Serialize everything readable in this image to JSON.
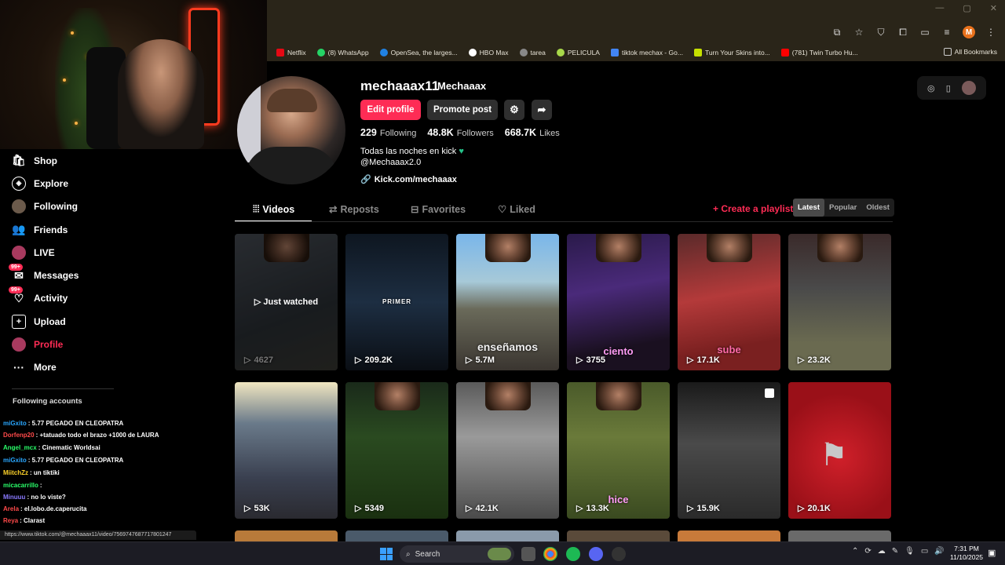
{
  "bookmarks": [
    {
      "label": "Netflix",
      "color": "#e50914"
    },
    {
      "label": "(8) WhatsApp",
      "color": "#25d366"
    },
    {
      "label": "OpenSea, the larges...",
      "color": "#2081e2"
    },
    {
      "label": "HBO Max",
      "color": "#ffffff"
    },
    {
      "label": "tarea",
      "color": "#888888"
    },
    {
      "label": "PELICULA",
      "color": "#a8d84a"
    },
    {
      "label": "tiktok mechax - Go...",
      "color": "#4285f4"
    },
    {
      "label": "Turn Your Skins into...",
      "color": "#c6e000"
    },
    {
      "label": "(781) Twin Turbo Hu...",
      "color": "#ff0000"
    }
  ],
  "all_bookmarks": "All Bookmarks",
  "profile_initial": "M",
  "sidebar": {
    "items": [
      {
        "label": "Shop",
        "icon": "shop-icon"
      },
      {
        "label": "Explore",
        "icon": "compass-icon"
      },
      {
        "label": "Following",
        "icon": "avatar-icon"
      },
      {
        "label": "Friends",
        "icon": "friends-icon"
      },
      {
        "label": "LIVE",
        "icon": "live-icon"
      },
      {
        "label": "Messages",
        "icon": "messages-icon",
        "badge": "99+"
      },
      {
        "label": "Activity",
        "icon": "activity-icon",
        "badge": "99+"
      },
      {
        "label": "Upload",
        "icon": "upload-icon"
      },
      {
        "label": "Profile",
        "icon": "profile-icon"
      },
      {
        "label": "More",
        "icon": "more-icon"
      }
    ],
    "following_accounts_title": "Following accounts"
  },
  "chat": [
    {
      "user": "miGxito",
      "msg": ": 5.77 PEGADO EN CLEOPATRA",
      "color": "#2aa7ff"
    },
    {
      "user": "Dorfenp20",
      "msg": ": +tatuado todo el brazo +1000 de LAURA",
      "color": "#ff4a4a"
    },
    {
      "user": "Angel_mcx",
      "msg": ": Cinematic Worldsai",
      "color": "#2aff6a"
    },
    {
      "user": "miGxito",
      "msg": ": 5.77 PEGADO EN CLEOPATRA",
      "color": "#2aa7ff"
    },
    {
      "user": "MiitchZz",
      "msg": ": un tiktiki",
      "color": "#ffd42a"
    },
    {
      "user": "micacarrillo",
      "msg": ":",
      "color": "#2aff6a"
    },
    {
      "user": "Minuuu",
      "msg": ": no lo viste?",
      "color": "#8a7aff"
    },
    {
      "user": "Arela",
      "msg": ": el.lobo.de.caperucita",
      "color": "#ff4a4a"
    },
    {
      "user": "Reya",
      "msg": ": Clarast",
      "color": "#ff4a4a"
    }
  ],
  "status_url": "https://www.tiktok.com/@mechaaax11/video/7569747687717801247",
  "profile": {
    "username": "mechaaax11",
    "nickname": "Mechaaax",
    "edit_label": "Edit profile",
    "promote_label": "Promote post",
    "following_count": "229",
    "following_label": "Following",
    "followers_count": "48.8K",
    "followers_label": "Followers",
    "likes_count": "668.7K",
    "likes_label": "Likes",
    "bio_line1": "Todas las noches en kick",
    "bio_line2": "@Mechaaax2.0",
    "link": "Kick.com/mechaaax"
  },
  "tabs": {
    "videos": "Videos",
    "reposts": "Reposts",
    "favorites": "Favorites",
    "liked": "Liked"
  },
  "create_playlist": "+ Create a playlist",
  "sort": {
    "latest": "Latest",
    "popular": "Popular",
    "oldest": "Oldest"
  },
  "videos": [
    {
      "views": "4627",
      "overlay": "Just watched",
      "caption": ""
    },
    {
      "views": "209.2K",
      "caption": "PRIMER"
    },
    {
      "views": "5.7M",
      "caption": "enseñamos"
    },
    {
      "views": "3755",
      "caption": "ciento"
    },
    {
      "views": "17.1K",
      "caption": "sube"
    },
    {
      "views": "23.2K",
      "caption": ""
    },
    {
      "views": "53K",
      "caption": ""
    },
    {
      "views": "5349",
      "caption": ""
    },
    {
      "views": "42.1K",
      "caption": ""
    },
    {
      "views": "13.3K",
      "caption": "hice"
    },
    {
      "views": "15.9K",
      "caption": ""
    },
    {
      "views": "20.1K",
      "caption": ""
    }
  ],
  "taskbar": {
    "search": "Search",
    "time": "7:31 PM",
    "date": "11/10/2025"
  },
  "colors": {
    "accent": "#fe2c55",
    "heart": "#25c28a"
  }
}
